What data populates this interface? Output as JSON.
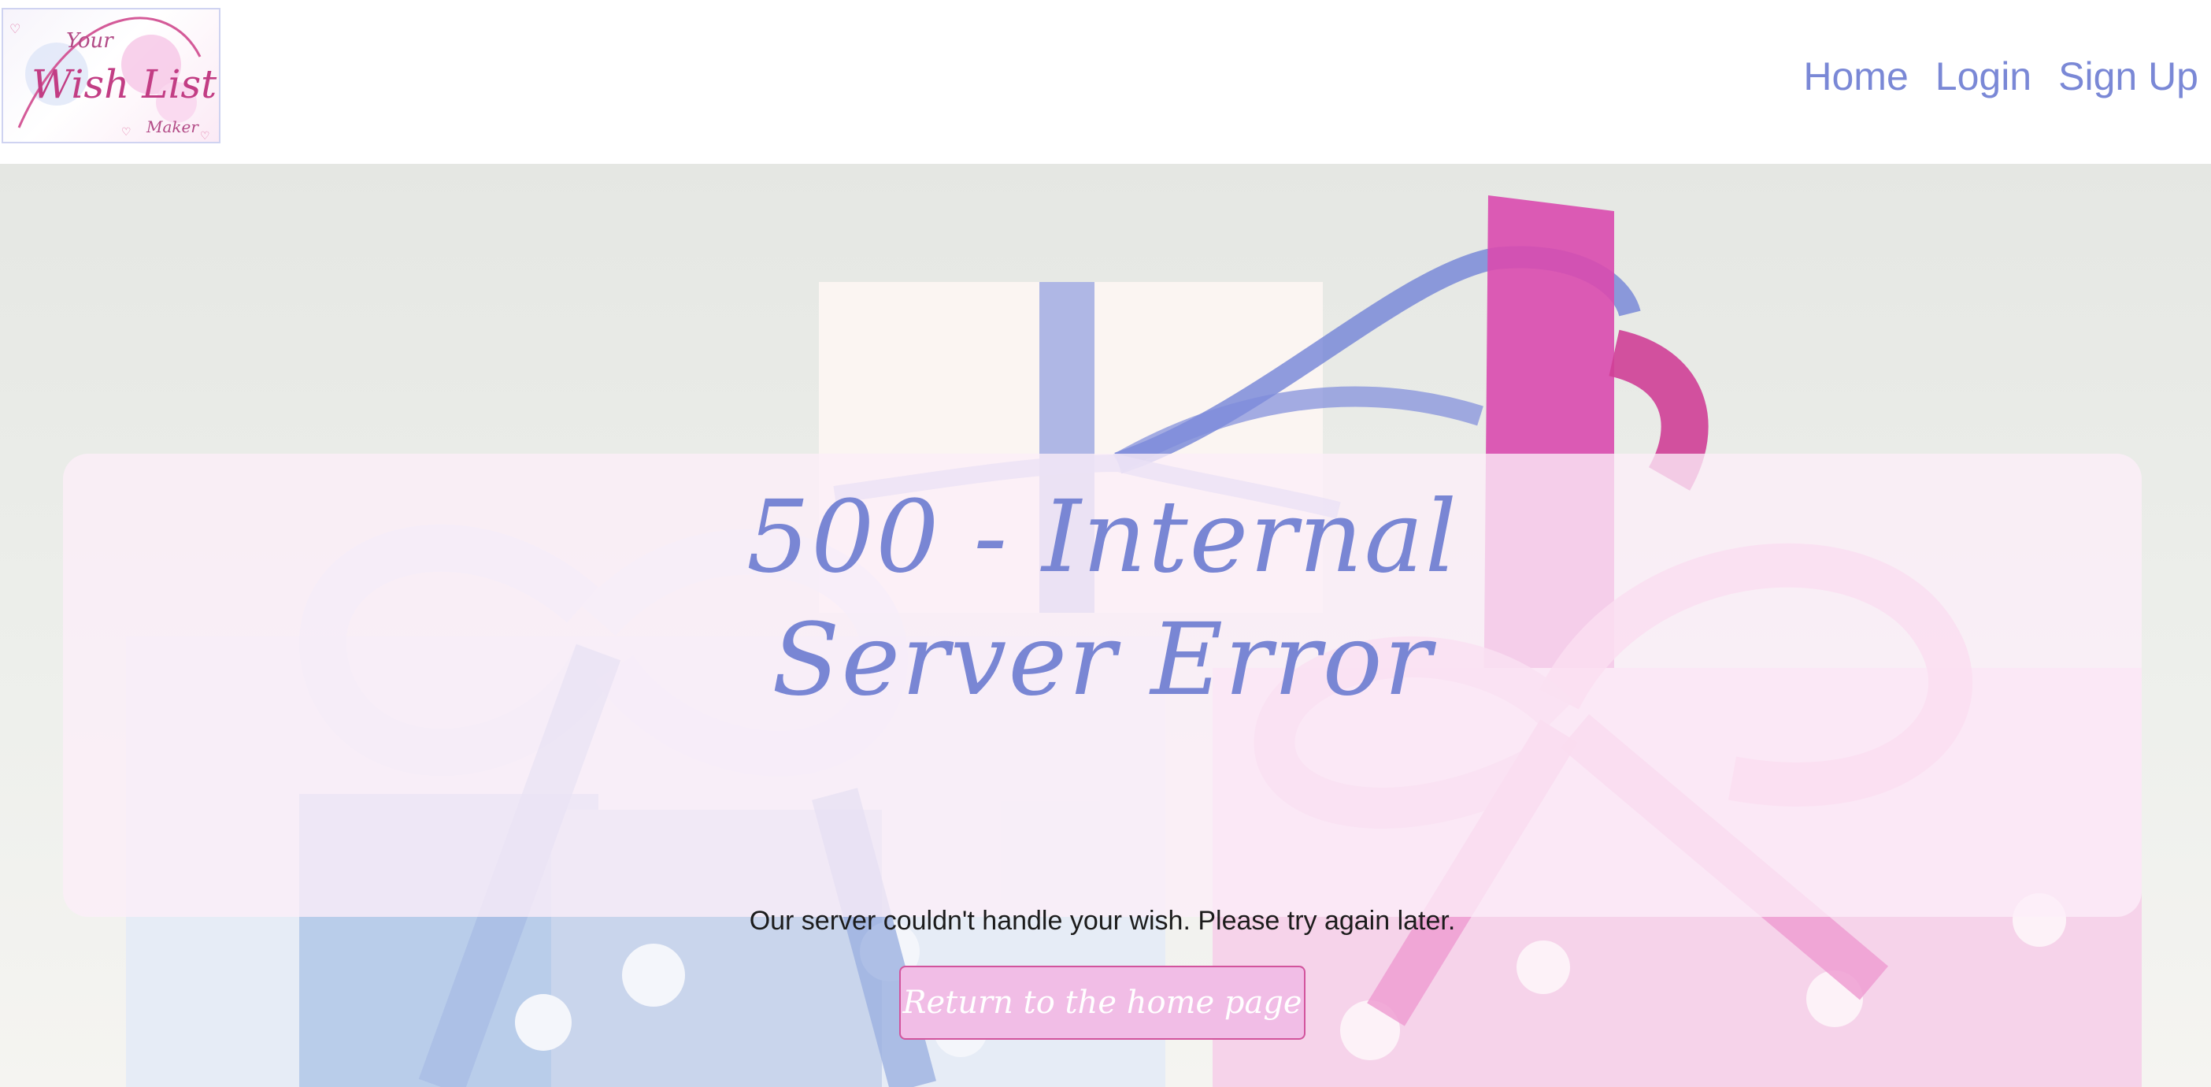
{
  "header": {
    "logo": {
      "text_top": "Your",
      "text_main": "Wish List",
      "text_bottom": "Maker"
    },
    "nav": [
      {
        "label": "Home"
      },
      {
        "label": "Login"
      },
      {
        "label": "Sign Up"
      }
    ]
  },
  "error": {
    "title": "500 - Internal Server Error",
    "message": "Our server couldn't handle your wish. Please try again later.",
    "button_label": "Return to the home page"
  },
  "colors": {
    "nav_link": "#7a88d6",
    "title": "#7986d4",
    "button_bg": "#f1bde6",
    "button_border": "#d2549d",
    "panel_bg": "#fceef8"
  }
}
